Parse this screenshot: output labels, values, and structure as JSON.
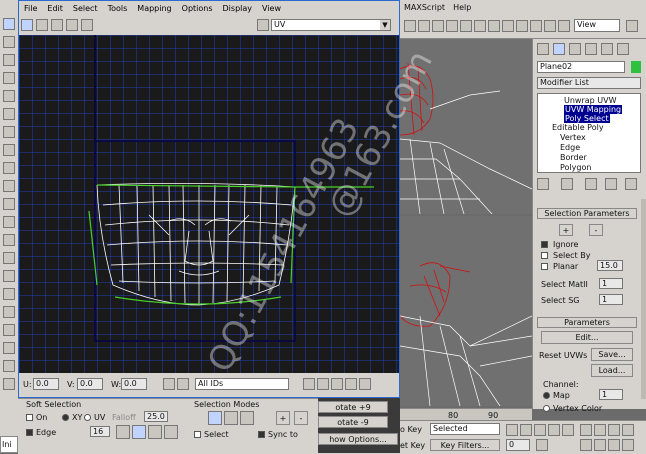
{
  "editor_menu": [
    "File",
    "Edit",
    "Select",
    "Tools",
    "Mapping",
    "Options",
    "Display",
    "View"
  ],
  "max_menu": [
    "MAXScript",
    "Help"
  ],
  "uv_dropdown": "UV",
  "view_dropdown": "View",
  "object_name": "Plane02",
  "modifier_list_label": "Modifier List",
  "modifier_stack": [
    "Unwrap UVW",
    "UVW Mapping",
    "Poly Select",
    "Editable Poly",
    "Vertex",
    "Edge",
    "Border",
    "Polygon"
  ],
  "selection_parameters": {
    "title": "Selection Parameters",
    "plus": "+",
    "minus": "-",
    "ignore": "Ignore",
    "select_by": "Select By",
    "planar": "Planar",
    "planar_value": "15.0",
    "select_matid": "Select MatII",
    "matid_value": "1",
    "select_sg": "Select SG",
    "sg_value": "1"
  },
  "parameters": {
    "title": "Parameters",
    "edit": "Edit...",
    "reset_uvws": "Reset UVWs",
    "save": "Save...",
    "load": "Load...",
    "channel": "Channel:",
    "map": "Map",
    "map_value": "1",
    "vertex_color": "Vertex Color"
  },
  "bottom_status": {
    "u_label": "U:",
    "u_value": "0.0",
    "v_label": "V:",
    "v_value": "0.0",
    "w_label": "W:",
    "w_value": "0.0",
    "filter": "All IDs"
  },
  "soft_selection": {
    "title": "Soft Selection",
    "on": "On",
    "xy": "XY",
    "uv": "UV",
    "falloff": "Falloff",
    "falloff_value": "25.0",
    "edge": "Edge",
    "edge_value": "16"
  },
  "selection_modes": {
    "title": "Selection Modes",
    "plus": "+",
    "minus": "-",
    "select": "Select",
    "sync_to": "Sync to"
  },
  "rotate_buttons": [
    "otate +9",
    "otate -9"
  ],
  "show_options": "how Options...",
  "timeline": {
    "t80": "80",
    "t90": "90"
  },
  "anim_bar": {
    "key_mode": "o Key",
    "selected": "Selected",
    "set_key": "et Key",
    "key_filters": "Key Filters...",
    "frame": "0"
  },
  "bottom_left": "Ini",
  "watermark": [
    "QQ:1154164963",
    "@163.com"
  ],
  "colors": {
    "grid_bg": "#1c1c1c",
    "grid_line": "#1e3caa",
    "wire": "#ffffff",
    "seam": "#49d12a",
    "ui": "#d6d3ce",
    "accent": "#000090",
    "red_wire": "#d01010"
  }
}
